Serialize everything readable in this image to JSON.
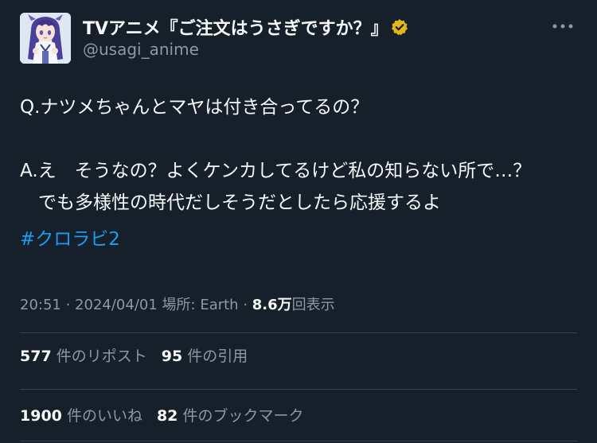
{
  "account": {
    "display_name": "TVアニメ『ご注文はうさぎですか？』",
    "handle": "@usagi_anime",
    "verified_badge_color": "#e2b719"
  },
  "icons": {
    "avatar": "anime-character-avatar",
    "verified": "verified-badge-icon",
    "more": "more-options-icon"
  },
  "tweet": {
    "text": "Q.ナツメちゃんとマヤは付き合ってるの？\n\nA.え　そうなの？よくケンカしてるけど私の知らない所で…？\n　でも多様性の時代だしそうだとしたら応援するよ",
    "hashtag": "#クロラビ2",
    "hashtag_color": "#1d9bf0"
  },
  "meta": {
    "time": "20:51",
    "separator": " · ",
    "date": "2024/04/01",
    "location": "場所: Earth",
    "views_count": "8.6万",
    "views_label": "回表示"
  },
  "stats": {
    "reposts_count": "577",
    "reposts_label": "件のリポスト",
    "quotes_count": "95",
    "quotes_label": "件の引用",
    "likes_count": "1900",
    "likes_label": "件のいいね",
    "bookmarks_count": "82",
    "bookmarks_label": "件のブックマーク"
  },
  "theme": {
    "background": "#15202b",
    "primary_text": "#f7f9f9",
    "secondary_text": "#8b98a5",
    "divider": "#38444d"
  }
}
